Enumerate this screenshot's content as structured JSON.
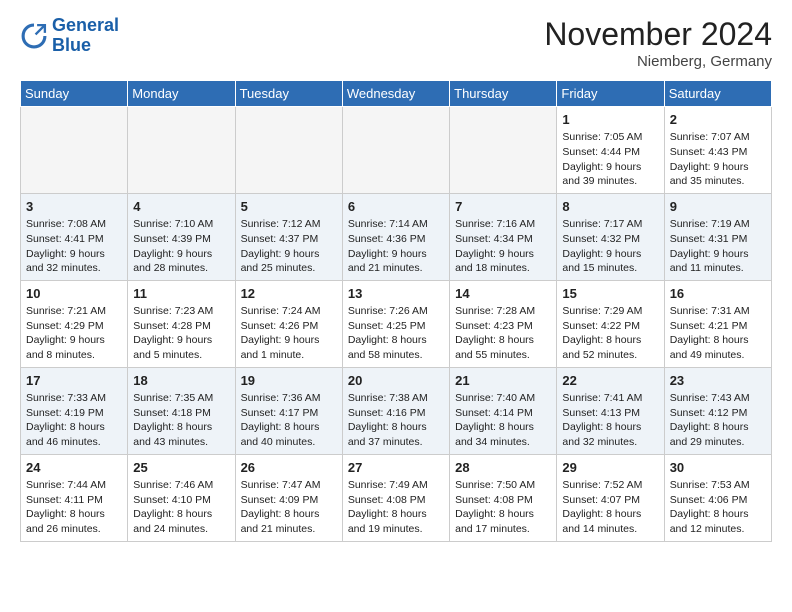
{
  "logo": {
    "line1": "General",
    "line2": "Blue"
  },
  "title": "November 2024",
  "location": "Niemberg, Germany",
  "days_of_week": [
    "Sunday",
    "Monday",
    "Tuesday",
    "Wednesday",
    "Thursday",
    "Friday",
    "Saturday"
  ],
  "weeks": [
    [
      {
        "day": "",
        "info": ""
      },
      {
        "day": "",
        "info": ""
      },
      {
        "day": "",
        "info": ""
      },
      {
        "day": "",
        "info": ""
      },
      {
        "day": "",
        "info": ""
      },
      {
        "day": "1",
        "info": "Sunrise: 7:05 AM\nSunset: 4:44 PM\nDaylight: 9 hours\nand 39 minutes."
      },
      {
        "day": "2",
        "info": "Sunrise: 7:07 AM\nSunset: 4:43 PM\nDaylight: 9 hours\nand 35 minutes."
      }
    ],
    [
      {
        "day": "3",
        "info": "Sunrise: 7:08 AM\nSunset: 4:41 PM\nDaylight: 9 hours\nand 32 minutes."
      },
      {
        "day": "4",
        "info": "Sunrise: 7:10 AM\nSunset: 4:39 PM\nDaylight: 9 hours\nand 28 minutes."
      },
      {
        "day": "5",
        "info": "Sunrise: 7:12 AM\nSunset: 4:37 PM\nDaylight: 9 hours\nand 25 minutes."
      },
      {
        "day": "6",
        "info": "Sunrise: 7:14 AM\nSunset: 4:36 PM\nDaylight: 9 hours\nand 21 minutes."
      },
      {
        "day": "7",
        "info": "Sunrise: 7:16 AM\nSunset: 4:34 PM\nDaylight: 9 hours\nand 18 minutes."
      },
      {
        "day": "8",
        "info": "Sunrise: 7:17 AM\nSunset: 4:32 PM\nDaylight: 9 hours\nand 15 minutes."
      },
      {
        "day": "9",
        "info": "Sunrise: 7:19 AM\nSunset: 4:31 PM\nDaylight: 9 hours\nand 11 minutes."
      }
    ],
    [
      {
        "day": "10",
        "info": "Sunrise: 7:21 AM\nSunset: 4:29 PM\nDaylight: 9 hours\nand 8 minutes."
      },
      {
        "day": "11",
        "info": "Sunrise: 7:23 AM\nSunset: 4:28 PM\nDaylight: 9 hours\nand 5 minutes."
      },
      {
        "day": "12",
        "info": "Sunrise: 7:24 AM\nSunset: 4:26 PM\nDaylight: 9 hours\nand 1 minute."
      },
      {
        "day": "13",
        "info": "Sunrise: 7:26 AM\nSunset: 4:25 PM\nDaylight: 8 hours\nand 58 minutes."
      },
      {
        "day": "14",
        "info": "Sunrise: 7:28 AM\nSunset: 4:23 PM\nDaylight: 8 hours\nand 55 minutes."
      },
      {
        "day": "15",
        "info": "Sunrise: 7:29 AM\nSunset: 4:22 PM\nDaylight: 8 hours\nand 52 minutes."
      },
      {
        "day": "16",
        "info": "Sunrise: 7:31 AM\nSunset: 4:21 PM\nDaylight: 8 hours\nand 49 minutes."
      }
    ],
    [
      {
        "day": "17",
        "info": "Sunrise: 7:33 AM\nSunset: 4:19 PM\nDaylight: 8 hours\nand 46 minutes."
      },
      {
        "day": "18",
        "info": "Sunrise: 7:35 AM\nSunset: 4:18 PM\nDaylight: 8 hours\nand 43 minutes."
      },
      {
        "day": "19",
        "info": "Sunrise: 7:36 AM\nSunset: 4:17 PM\nDaylight: 8 hours\nand 40 minutes."
      },
      {
        "day": "20",
        "info": "Sunrise: 7:38 AM\nSunset: 4:16 PM\nDaylight: 8 hours\nand 37 minutes."
      },
      {
        "day": "21",
        "info": "Sunrise: 7:40 AM\nSunset: 4:14 PM\nDaylight: 8 hours\nand 34 minutes."
      },
      {
        "day": "22",
        "info": "Sunrise: 7:41 AM\nSunset: 4:13 PM\nDaylight: 8 hours\nand 32 minutes."
      },
      {
        "day": "23",
        "info": "Sunrise: 7:43 AM\nSunset: 4:12 PM\nDaylight: 8 hours\nand 29 minutes."
      }
    ],
    [
      {
        "day": "24",
        "info": "Sunrise: 7:44 AM\nSunset: 4:11 PM\nDaylight: 8 hours\nand 26 minutes."
      },
      {
        "day": "25",
        "info": "Sunrise: 7:46 AM\nSunset: 4:10 PM\nDaylight: 8 hours\nand 24 minutes."
      },
      {
        "day": "26",
        "info": "Sunrise: 7:47 AM\nSunset: 4:09 PM\nDaylight: 8 hours\nand 21 minutes."
      },
      {
        "day": "27",
        "info": "Sunrise: 7:49 AM\nSunset: 4:08 PM\nDaylight: 8 hours\nand 19 minutes."
      },
      {
        "day": "28",
        "info": "Sunrise: 7:50 AM\nSunset: 4:08 PM\nDaylight: 8 hours\nand 17 minutes."
      },
      {
        "day": "29",
        "info": "Sunrise: 7:52 AM\nSunset: 4:07 PM\nDaylight: 8 hours\nand 14 minutes."
      },
      {
        "day": "30",
        "info": "Sunrise: 7:53 AM\nSunset: 4:06 PM\nDaylight: 8 hours\nand 12 minutes."
      }
    ]
  ]
}
